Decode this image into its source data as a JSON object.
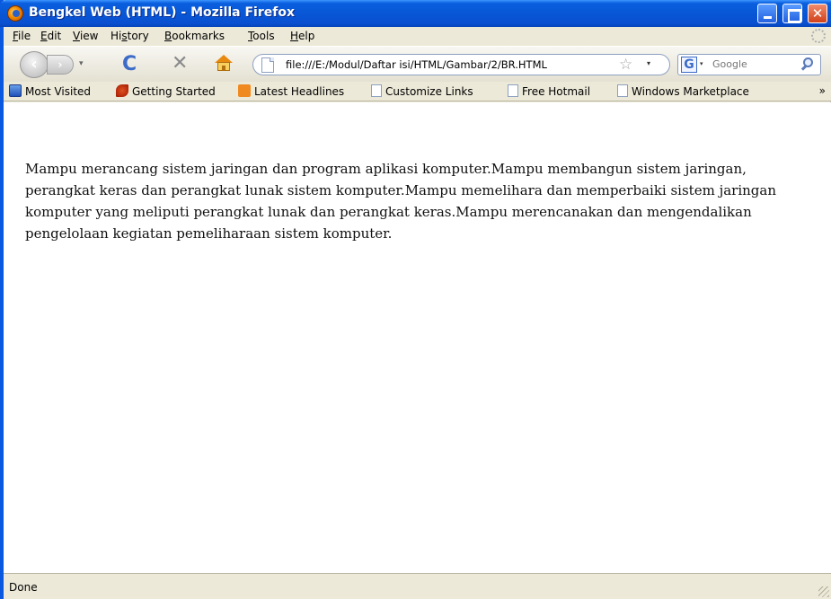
{
  "window": {
    "title": "Bengkel Web (HTML) - Mozilla Firefox",
    "minimize_label": "_",
    "maximize_label": "□",
    "close_label": "✕"
  },
  "menu": {
    "items": [
      {
        "u": "F",
        "rest": "ile"
      },
      {
        "u": "E",
        "rest": "dit"
      },
      {
        "u": "V",
        "rest": "iew"
      },
      {
        "pre": "Hi",
        "u": "s",
        "rest": "tory"
      },
      {
        "u": "B",
        "rest": "ookmarks"
      },
      {
        "u": "T",
        "rest": "ools"
      },
      {
        "u": "H",
        "rest": "elp"
      }
    ]
  },
  "nav": {
    "back_label": "‹",
    "forward_label": "›",
    "history_label": "▾",
    "reload_label": "C",
    "stop_label": "✕",
    "url": "file:///E:/Modul/Daftar isi/HTML/Gambar/2/BR.HTML",
    "star_label": "☆",
    "url_dropdown_label": "▾"
  },
  "search": {
    "engine_label": "G",
    "dropdown_label": "▾",
    "placeholder": "Google"
  },
  "bookmarks": {
    "items": [
      {
        "label": "Most Visited",
        "icon": "most-visited-icon"
      },
      {
        "label": "Getting Started",
        "icon": "firefox-icon"
      },
      {
        "label": "Latest Headlines",
        "icon": "rss-icon"
      },
      {
        "label": "Customize Links",
        "icon": "page-icon"
      },
      {
        "label": "Free Hotmail",
        "icon": "page-icon"
      },
      {
        "label": "Windows Marketplace",
        "icon": "page-icon"
      }
    ],
    "more_label": "»"
  },
  "content": {
    "lines": [
      "Mampu merancang sistem jaringan dan program aplikasi komputer.Mampu membangun sistem jaringan,",
      "perangkat keras dan perangkat lunak sistem komputer.Mampu memelihara dan memperbaiki sistem jaringan",
      "komputer yang meliputi perangkat lunak dan perangkat keras.Mampu merencanakan dan mengendalikan",
      "pengelolaan kegiatan pemeliharaan sistem komputer."
    ]
  },
  "status": {
    "text": "Done"
  }
}
